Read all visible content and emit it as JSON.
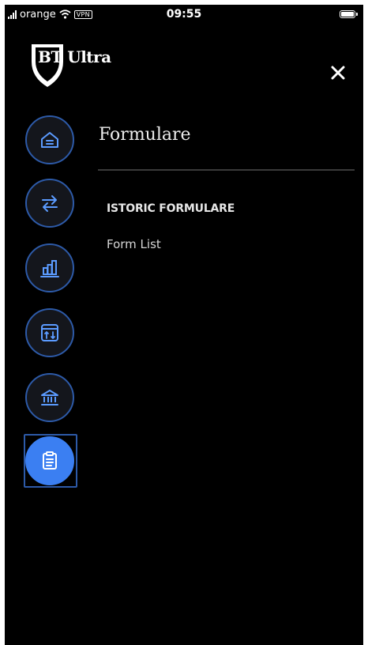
{
  "status_bar": {
    "carrier": "orange",
    "vpn": "VPN",
    "time": "09:55"
  },
  "header": {
    "logo_text": "BT Ultra",
    "close_label": "×"
  },
  "sidebar": {
    "items": [
      {
        "name": "home",
        "icon": "home-icon",
        "active": false
      },
      {
        "name": "transfers",
        "icon": "transfer-arrows-icon",
        "active": false
      },
      {
        "name": "reports",
        "icon": "bar-chart-icon",
        "active": false
      },
      {
        "name": "exchange",
        "icon": "calendar-exchange-icon",
        "active": false
      },
      {
        "name": "bank",
        "icon": "bank-icon",
        "active": false
      },
      {
        "name": "forms",
        "icon": "clipboard-icon",
        "active": true
      }
    ],
    "accent_color": "#3b7ff2",
    "border_color": "#2d5aa8"
  },
  "main": {
    "title": "Formulare",
    "section_heading": "ISTORIC FORMULARE",
    "links": [
      "Form List"
    ]
  }
}
